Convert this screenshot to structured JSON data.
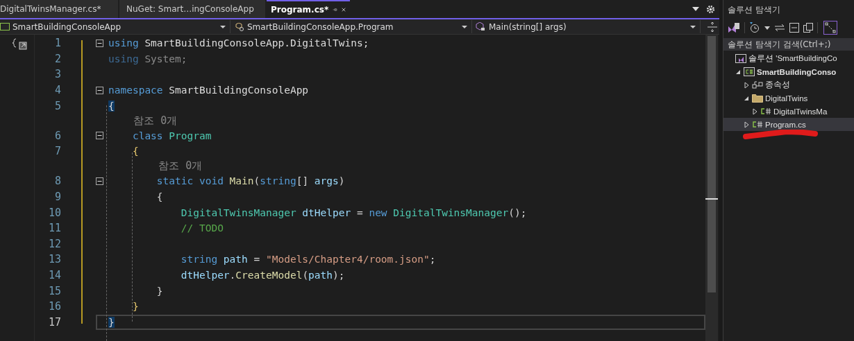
{
  "tabs": [
    {
      "label": "DigitalTwinsManager.cs*",
      "selected": false
    },
    {
      "label": "NuGet: Smart…ingConsoleApp",
      "selected": false
    },
    {
      "label": "Program.cs*",
      "selected": true
    }
  ],
  "navbar": {
    "project": "SmartBuildingConsoleApp",
    "class": "SmartBuildingConsoleApp.Program",
    "member": "Main(string[] args)"
  },
  "code_lines": [
    {
      "kind": "code",
      "number": "1",
      "collapsible": true,
      "faded": false,
      "current": false,
      "tokens": [
        {
          "text": "using",
          "kind": "keyword"
        },
        {
          "text": " SmartBuildingConsoleApp.DigitalTwins;",
          "kind": "plain"
        }
      ]
    },
    {
      "kind": "code",
      "number": "2",
      "collapsible": false,
      "faded": true,
      "current": false,
      "tokens": [
        {
          "text": "using",
          "kind": "keyword"
        },
        {
          "text": " System;",
          "kind": "plain"
        }
      ]
    },
    {
      "kind": "code",
      "number": "3",
      "collapsible": false,
      "current": false
    },
    {
      "kind": "code",
      "number": "4",
      "collapsible": true,
      "faded": false,
      "current": false,
      "tokens": [
        {
          "text": "namespace",
          "kind": "keyword"
        },
        {
          "text": " SmartBuildingConsoleApp",
          "kind": "plain"
        }
      ]
    },
    {
      "kind": "code",
      "number": "5",
      "collapsible": false,
      "faded": false,
      "current": false,
      "tokens": [
        {
          "text": "{",
          "kind": "matched-brace"
        }
      ]
    },
    {
      "kind": "lens",
      "text": "    참조 0개"
    },
    {
      "kind": "code",
      "number": "6",
      "collapsible": true,
      "faded": false,
      "current": false,
      "tokens": [
        {
          "text": "    class",
          "kind": "keyword"
        },
        {
          "text": " Program",
          "kind": "type"
        }
      ]
    },
    {
      "kind": "code",
      "number": "7",
      "collapsible": false,
      "faded": false,
      "current": false,
      "tokens": [
        {
          "text": "    {",
          "kind": "brace"
        }
      ]
    },
    {
      "kind": "lens",
      "text": "        참조 0개"
    },
    {
      "kind": "code",
      "number": "8",
      "collapsible": true,
      "faded": false,
      "current": false,
      "tokens": [
        {
          "text": "        static void",
          "kind": "keyword"
        },
        {
          "text": " Main",
          "kind": "method"
        },
        {
          "text": "(",
          "kind": "punct"
        },
        {
          "text": "string",
          "kind": "keyword"
        },
        {
          "text": "[]",
          "kind": "punct"
        },
        {
          "text": " args",
          "kind": "param"
        },
        {
          "text": ")",
          "kind": "punct"
        }
      ]
    },
    {
      "kind": "code",
      "number": "9",
      "collapsible": false,
      "faded": false,
      "current": false,
      "tokens": [
        {
          "text": "        {",
          "kind": "punct"
        }
      ]
    },
    {
      "kind": "code",
      "number": "10",
      "collapsible": false,
      "faded": false,
      "current": false,
      "tokens": [
        {
          "text": "            DigitalTwinsManager",
          "kind": "type"
        },
        {
          "text": " dtHelper",
          "kind": "param"
        },
        {
          "text": " =",
          "kind": "punct"
        },
        {
          "text": " new",
          "kind": "keyword"
        },
        {
          "text": " DigitalTwinsManager",
          "kind": "type"
        },
        {
          "text": "();",
          "kind": "punct"
        }
      ]
    },
    {
      "kind": "code",
      "number": "11",
      "collapsible": false,
      "faded": false,
      "current": false,
      "tokens": [
        {
          "text": "            // TODO",
          "kind": "comment"
        }
      ]
    },
    {
      "kind": "code",
      "number": "12",
      "collapsible": false,
      "current": false
    },
    {
      "kind": "code",
      "number": "13",
      "collapsible": false,
      "faded": false,
      "current": false,
      "tokens": [
        {
          "text": "            string",
          "kind": "keyword"
        },
        {
          "text": " path",
          "kind": "param"
        },
        {
          "text": " =",
          "kind": "punct"
        },
        {
          "text": " \"Models/Chapter4/room.json\"",
          "kind": "string"
        },
        {
          "text": ";",
          "kind": "punct"
        }
      ]
    },
    {
      "kind": "code",
      "number": "14",
      "collapsible": false,
      "faded": false,
      "current": false,
      "tokens": [
        {
          "text": "            dtHelper",
          "kind": "param"
        },
        {
          "text": ".",
          "kind": "punct"
        },
        {
          "text": "CreateModel",
          "kind": "method"
        },
        {
          "text": "(",
          "kind": "punct"
        },
        {
          "text": "path",
          "kind": "param"
        },
        {
          "text": ");",
          "kind": "punct"
        }
      ]
    },
    {
      "kind": "code",
      "number": "15",
      "collapsible": false,
      "faded": false,
      "current": false,
      "tokens": [
        {
          "text": "        }",
          "kind": "punct"
        }
      ]
    },
    {
      "kind": "code",
      "number": "16",
      "collapsible": false,
      "faded": false,
      "current": false,
      "tokens": [
        {
          "text": "    }",
          "kind": "brace"
        }
      ]
    },
    {
      "kind": "code",
      "number": "17",
      "collapsible": false,
      "faded": false,
      "current": true,
      "tokens": [
        {
          "text": "}",
          "kind": "matched-brace"
        }
      ]
    }
  ],
  "solution_explorer": {
    "title": "솔루션 탐색기",
    "search": {
      "placeholder": "솔루션 탐색기 검색(Ctrl+;)"
    },
    "tree": [
      {
        "label": "솔루션 'SmartBuildingCo",
        "kind": "solution",
        "selected": false,
        "children": [
          {
            "label": "SmartBuildingConso",
            "kind": "project",
            "expanded": true,
            "selected": false,
            "children": [
              {
                "label": "종속성",
                "kind": "dependencies",
                "expanded": false,
                "selected": false
              },
              {
                "label": "DigitalTwins",
                "kind": "folder",
                "expanded": true,
                "selected": false,
                "children": [
                  {
                    "label": "DigitalTwinsMa",
                    "kind": "file",
                    "expanded": false,
                    "selected": false
                  }
                ]
              },
              {
                "label": "Program.cs",
                "kind": "file",
                "expanded": false,
                "selected": true
              }
            ]
          }
        ]
      }
    ]
  }
}
